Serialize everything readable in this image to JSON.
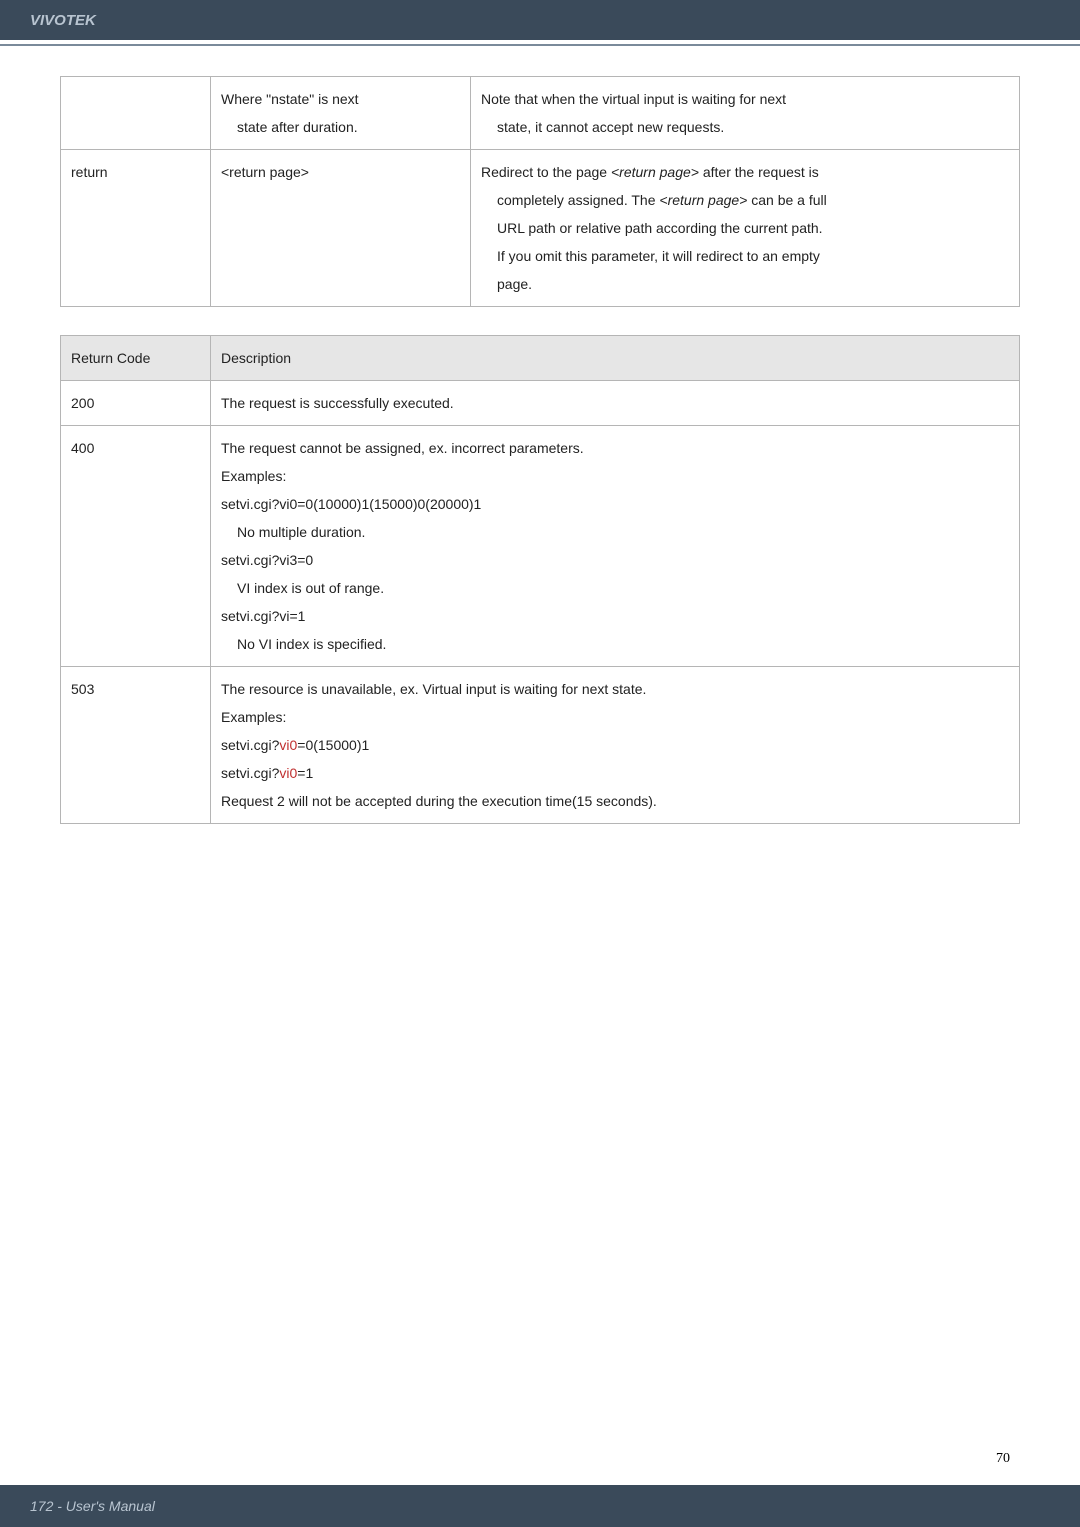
{
  "header": {
    "brand": "VIVOTEK"
  },
  "table1": {
    "rows": [
      {
        "c1": "",
        "c2a": "Where \"nstate\" is next",
        "c2b": "state after duration.",
        "c3a": "Note that when the virtual input is waiting for next",
        "c3b": "state, it cannot accept new requests."
      },
      {
        "c1": "return",
        "c2": "<return page>",
        "c3_l1a": "Redirect to the page ",
        "c3_l1_ital": "<return page>",
        "c3_l1b": " after the request is",
        "c3_l2a": "completely assigned. The ",
        "c3_l2_ital": "<return page>",
        "c3_l2b": " can be a full",
        "c3_l3": "URL path or relative path according the current path.",
        "c3_l4": "If you omit this parameter, it will redirect to an empty",
        "c3_l5": "page."
      }
    ]
  },
  "table2": {
    "head": {
      "c1": "Return Code",
      "c2": "Description"
    },
    "r200": {
      "c1": "200",
      "c2": "The request is successfully executed."
    },
    "r400": {
      "c1": "400",
      "l1": "The request cannot be assigned, ex. incorrect parameters.",
      "l2": "Examples:",
      "l3": "setvi.cgi?vi0=0(10000)1(15000)0(20000)1",
      "l4": "No multiple duration.",
      "l5": "setvi.cgi?vi3=0",
      "l6": "VI index is out of range.",
      "l7": "setvi.cgi?vi=1",
      "l8": "No VI index is specified."
    },
    "r503": {
      "c1": "503",
      "l1": "The resource is unavailable, ex. Virtual input is waiting for next state.",
      "l2": "Examples:",
      "l3a": "setvi.cgi?",
      "l3red": "vi0",
      "l3b": "=0(15000)1",
      "l4a": "setvi.cgi?",
      "l4red": "vi0",
      "l4b": "=1",
      "l5": "Request 2 will not be accepted during the execution time(15 seconds)."
    }
  },
  "footer": {
    "text": "172 - User's Manual"
  },
  "page_number": "70"
}
